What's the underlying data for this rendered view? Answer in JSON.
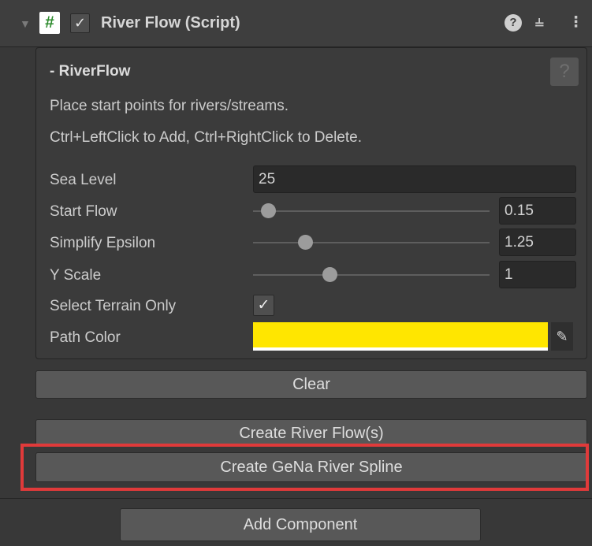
{
  "component": {
    "title": "River Flow (Script)",
    "script_icon_glyph": "#",
    "enabled_check": "✓",
    "icons": [
      "help-icon",
      "presets-icon",
      "more-options-icon"
    ]
  },
  "panel": {
    "title": "- RiverFlow",
    "help_glyph": "?",
    "description": [
      "Place start points for rivers/streams.",
      "Ctrl+LeftClick to Add, Ctrl+RightClick to Delete."
    ],
    "fields": {
      "sea_level": {
        "label": "Sea Level",
        "value": "25"
      },
      "start_flow": {
        "label": "Start Flow",
        "value": "0.15",
        "slider_fraction": 0.08
      },
      "simplify_epsilon": {
        "label": "Simplify Epsilon",
        "value": "1.25",
        "slider_fraction": 0.22
      },
      "y_scale": {
        "label": "Y Scale",
        "value": "1",
        "slider_fraction": 0.32
      },
      "select_terrain_only": {
        "label": "Select Terrain Only",
        "checked": true,
        "check": "✓"
      },
      "path_color": {
        "label": "Path Color",
        "color": "#ffe600"
      }
    }
  },
  "buttons": {
    "clear": "Clear",
    "create_river_flow": "Create River Flow(s)",
    "create_gena_river_spline": "Create GeNa River Spline",
    "add_component": "Add Component"
  },
  "colors": {
    "background": "#383838",
    "highlight": "#e03a3a",
    "button": "#585858",
    "field": "#2a2a2a"
  }
}
